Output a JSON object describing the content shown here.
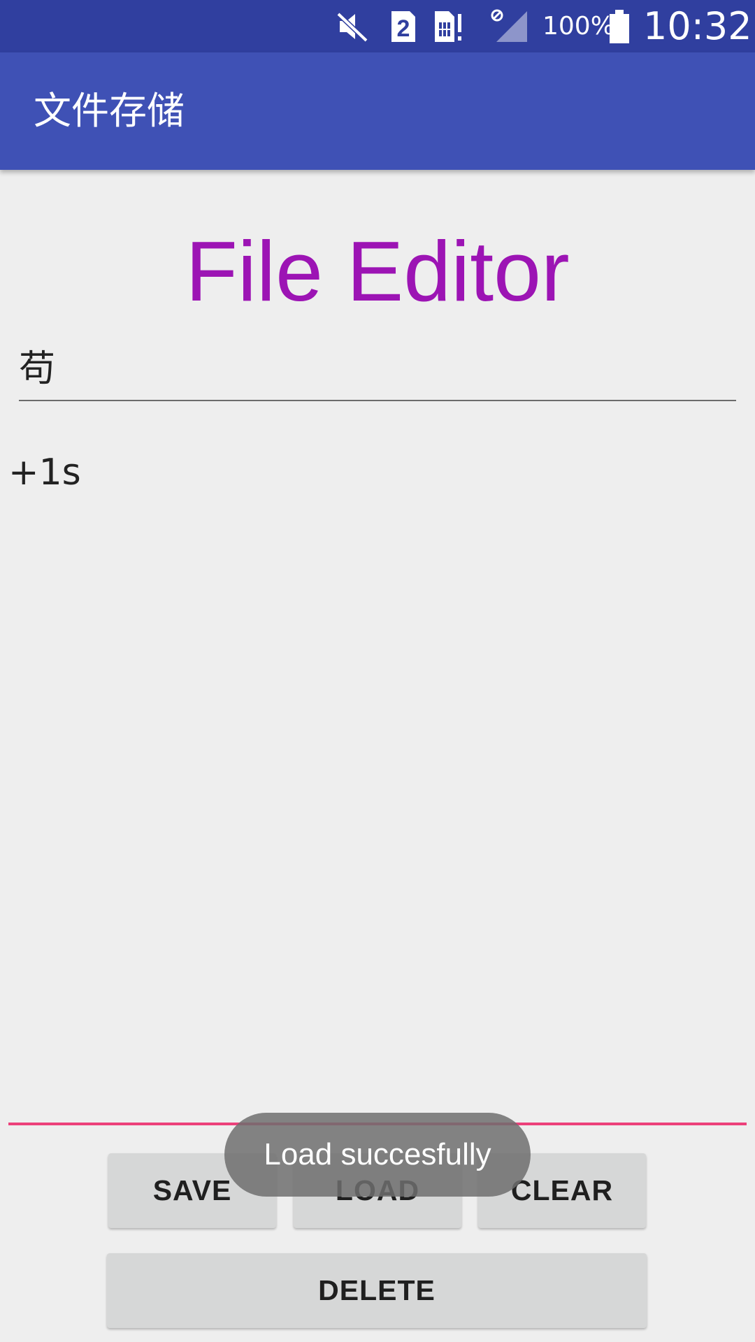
{
  "status_bar": {
    "battery_percent": "100%",
    "time": "10:32",
    "icons": [
      "mute-icon",
      "sim2-icon",
      "sim-alert-icon",
      "no-signal-icon",
      "battery-icon"
    ]
  },
  "app_bar": {
    "title": "文件存储"
  },
  "main": {
    "heading": "File Editor",
    "filename_value": "苟",
    "content_value": "+1s"
  },
  "buttons": {
    "save": "SAVE",
    "load": "LOAD",
    "clear": "CLEAR",
    "delete": "DELETE"
  },
  "toast": {
    "message": "Load succesfully"
  },
  "colors": {
    "status_bar": "#303f9f",
    "app_bar": "#3f51b5",
    "heading": "#9c14b4",
    "focused_underline": "#ec407a"
  }
}
